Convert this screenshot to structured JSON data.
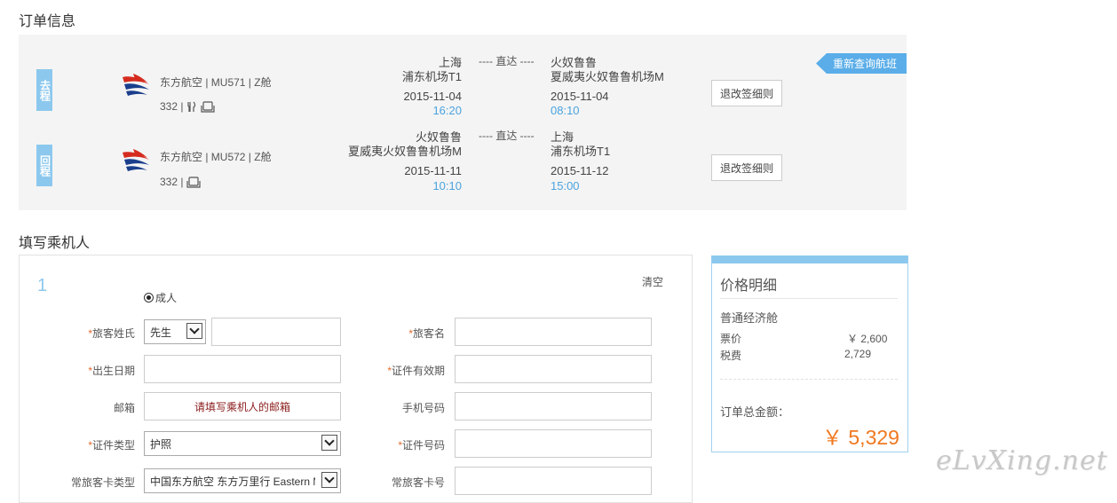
{
  "order_section": {
    "title": "订单信息"
  },
  "passenger_section": {
    "title": "填写乘机人"
  },
  "flights": [
    {
      "tag": "去程",
      "airline": "东方航空 | MU571 | Z舱",
      "equipment": "332 |",
      "equipment_icons": [
        "meal-icon",
        "seat-icon"
      ],
      "depart_city": "上海",
      "depart_airport": "浦东机场T1",
      "depart_date": "2015-11-04",
      "depart_time": "16:20",
      "direct_label": "---- 直达 ----",
      "arrive_city": "火奴鲁鲁",
      "arrive_airport": "夏威夷火奴鲁鲁机场M",
      "arrive_date": "2015-11-04",
      "arrive_time": "08:10",
      "rule_button": "退改签细则"
    },
    {
      "tag": "回程",
      "airline": "东方航空 | MU572 | Z舱",
      "equipment": "332 |",
      "equipment_icons": [
        "seat-icon"
      ],
      "depart_city": "火奴鲁鲁",
      "depart_airport": "夏威夷火奴鲁鲁机场M",
      "depart_date": "2015-11-11",
      "depart_time": "10:10",
      "direct_label": "---- 直达 ----",
      "arrive_city": "上海",
      "arrive_airport": "浦东机场T1",
      "arrive_date": "2015-11-12",
      "arrive_time": "15:00",
      "rule_button": "退改签细则"
    }
  ],
  "requery_button": "重新查询航班",
  "passenger_form": {
    "index": "1",
    "clear_label": "清空",
    "passenger_type": "成人",
    "fields": {
      "surname_label": "旅客姓氏",
      "title_select": "先生",
      "given_name_label": "旅客名",
      "birthdate_label": "出生日期",
      "id_expiry_label": "证件有效期",
      "email_label": "邮箱",
      "email_placeholder": "请填写乘机人的邮箱",
      "phone_label": "手机号码",
      "id_type_label": "证件类型",
      "id_type_value": "护照",
      "id_number_label": "证件号码",
      "ff_type_label": "常旅客卡类型",
      "ff_type_value": "中国东方航空 东方万里行 Eastern Miles",
      "ff_number_label": "常旅客卡号"
    },
    "required_mark": "*"
  },
  "price_detail": {
    "title": "价格明细",
    "cabin": "普通经济舱",
    "rows": [
      {
        "label": "票价",
        "value": "￥ 2,600"
      },
      {
        "label": "税费",
        "value": "2,729"
      }
    ],
    "total_label": "订单总金额：",
    "total_value": "￥ 5,329"
  },
  "watermark": "eLvXing.net",
  "colors": {
    "accent": "#8cc8ee",
    "link_blue": "#4aa3df",
    "price_orange": "#f07820",
    "panel_bg": "#f4f4f4"
  }
}
